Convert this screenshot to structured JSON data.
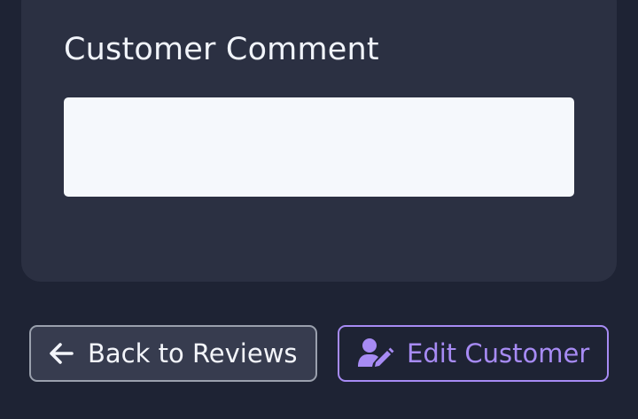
{
  "comment_section": {
    "title": "Customer Comment",
    "comment_value": ""
  },
  "actions": {
    "back_label": "Back to Reviews",
    "back_icon": "arrow-left-icon",
    "edit_label": "Edit Customer",
    "edit_icon": "user-edit-icon"
  },
  "colors": {
    "background": "#1e2334",
    "card": "#2b3042",
    "accent": "#a78bf4"
  }
}
